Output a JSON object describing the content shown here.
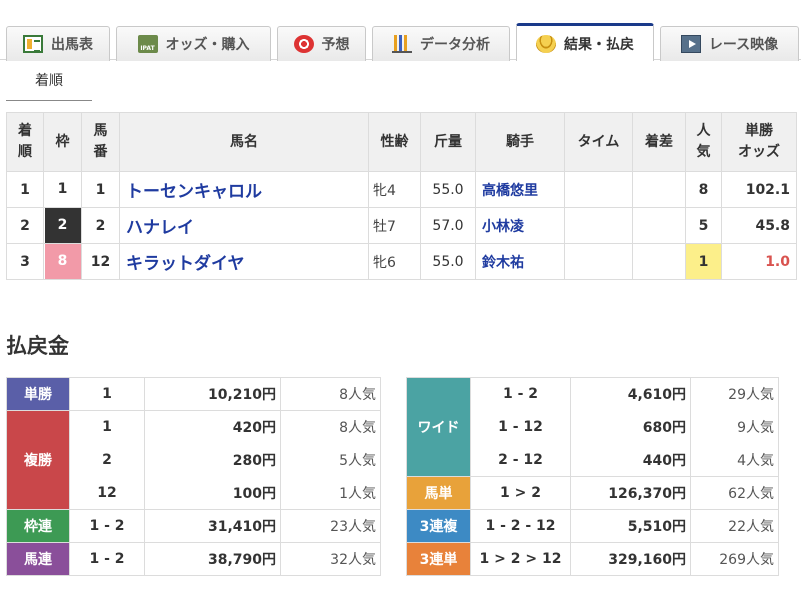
{
  "tabs": [
    {
      "label": "出馬表",
      "icon": "entry-list-icon",
      "active": false
    },
    {
      "label": "オッズ・購入",
      "icon": "odds-ipat-icon",
      "active": false
    },
    {
      "label": "予想",
      "icon": "target-icon",
      "active": false
    },
    {
      "label": "データ分析",
      "icon": "bar-chart-icon",
      "active": false
    },
    {
      "label": "結果・払戻",
      "icon": "coins-icon",
      "active": true
    },
    {
      "label": "レース映像",
      "icon": "video-icon",
      "active": false
    }
  ],
  "subtab": "着順",
  "results": {
    "headers": {
      "rank": "着\n順",
      "waku": "枠",
      "umaban": "馬\n番",
      "name": "馬名",
      "sexage": "性齢",
      "weight": "斤量",
      "jockey": "騎手",
      "time": "タイム",
      "margin": "着差",
      "pop": "人\n気",
      "odds": "単勝\nオッズ"
    },
    "rows": [
      {
        "rank": "1",
        "waku": "1",
        "umaban": "1",
        "name": "トーセンキャロル",
        "sexage": "牝4",
        "weight": "55.0",
        "jockey": "高橋悠里",
        "time": "",
        "margin": "",
        "pop": "8",
        "odds": "102.1"
      },
      {
        "rank": "2",
        "waku": "2",
        "umaban": "2",
        "name": "ハナレイ",
        "sexage": "牡7",
        "weight": "57.0",
        "jockey": "小林凌",
        "time": "",
        "margin": "",
        "pop": "5",
        "odds": "45.8"
      },
      {
        "rank": "3",
        "waku": "8",
        "umaban": "12",
        "name": "キラットダイヤ",
        "sexage": "牝6",
        "weight": "55.0",
        "jockey": "鈴木祐",
        "time": "",
        "margin": "",
        "pop": "1",
        "odds": "1.0"
      }
    ]
  },
  "payout_title": "払戻金",
  "payout_left": [
    {
      "type": "単勝",
      "color": "#5a5fa8",
      "entries": [
        {
          "num": "1",
          "amount": "10,210円",
          "pop": "8人気"
        }
      ]
    },
    {
      "type": "複勝",
      "color": "#c9474a",
      "entries": [
        {
          "num": "1",
          "amount": "420円",
          "pop": "8人気"
        },
        {
          "num": "2",
          "amount": "280円",
          "pop": "5人気"
        },
        {
          "num": "12",
          "amount": "100円",
          "pop": "1人気"
        }
      ]
    },
    {
      "type": "枠連",
      "color": "#3d9a54",
      "entries": [
        {
          "num": "1 - 2",
          "amount": "31,410円",
          "pop": "23人気"
        }
      ]
    },
    {
      "type": "馬連",
      "color": "#8a4f9a",
      "entries": [
        {
          "num": "1 - 2",
          "amount": "38,790円",
          "pop": "32人気"
        }
      ]
    }
  ],
  "payout_right": [
    {
      "type": "ワイド",
      "color": "#4ba3a3",
      "entries": [
        {
          "num": "1 - 2",
          "amount": "4,610円",
          "pop": "29人気"
        },
        {
          "num": "1 - 12",
          "amount": "680円",
          "pop": "9人気"
        },
        {
          "num": "2 - 12",
          "amount": "440円",
          "pop": "4人気"
        }
      ]
    },
    {
      "type": "馬単",
      "color": "#e8a23a",
      "entries": [
        {
          "num": "1 > 2",
          "amount": "126,370円",
          "pop": "62人気"
        }
      ]
    },
    {
      "type": "3連複",
      "color": "#3d8ac4",
      "entries": [
        {
          "num": "1 - 2 - 12",
          "amount": "5,510円",
          "pop": "22人気"
        }
      ]
    },
    {
      "type": "3連単",
      "color": "#e8823a",
      "entries": [
        {
          "num": "1 > 2 > 12",
          "amount": "329,160円",
          "pop": "269人気"
        }
      ]
    }
  ],
  "colors": {
    "waku": {
      "1": {
        "bg": "#ffffff",
        "fg": "#333333"
      },
      "2": {
        "bg": "#333333",
        "fg": "#ffffff"
      },
      "8": {
        "bg": "#f29aa8",
        "fg": "#ffffff"
      }
    },
    "accent": "#1a3a8a",
    "link": "#1f3ba0"
  }
}
